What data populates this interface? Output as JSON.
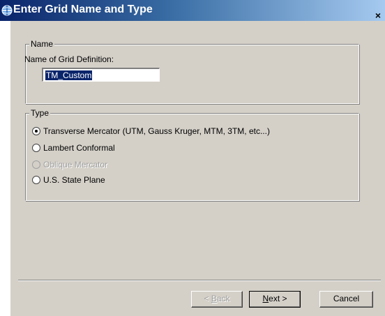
{
  "window": {
    "title": "Enter Grid Name and Type",
    "close_glyph": "×"
  },
  "name_group": {
    "legend": "Name",
    "field_label": "Name of Grid Definition:",
    "field_value": "TM_Custom"
  },
  "type_group": {
    "legend": "Type",
    "options": [
      {
        "label": "Transverse Mercator (UTM, Gauss Kruger, MTM, 3TM, etc...)",
        "checked": true,
        "disabled": false
      },
      {
        "label": "Lambert Conformal",
        "checked": false,
        "disabled": false
      },
      {
        "label": "Oblique Mercator",
        "checked": false,
        "disabled": true
      },
      {
        "label": "U.S. State Plane",
        "checked": false,
        "disabled": false
      }
    ]
  },
  "buttons": {
    "back_prefix": "< ",
    "back_hotkey": "B",
    "back_rest": "ack",
    "next_hotkey": "N",
    "next_rest": "ext >",
    "cancel": "Cancel"
  },
  "colors": {
    "title_start": "#0a246a",
    "title_end": "#a6caf0",
    "dialog_bg": "#d4d0c8"
  }
}
